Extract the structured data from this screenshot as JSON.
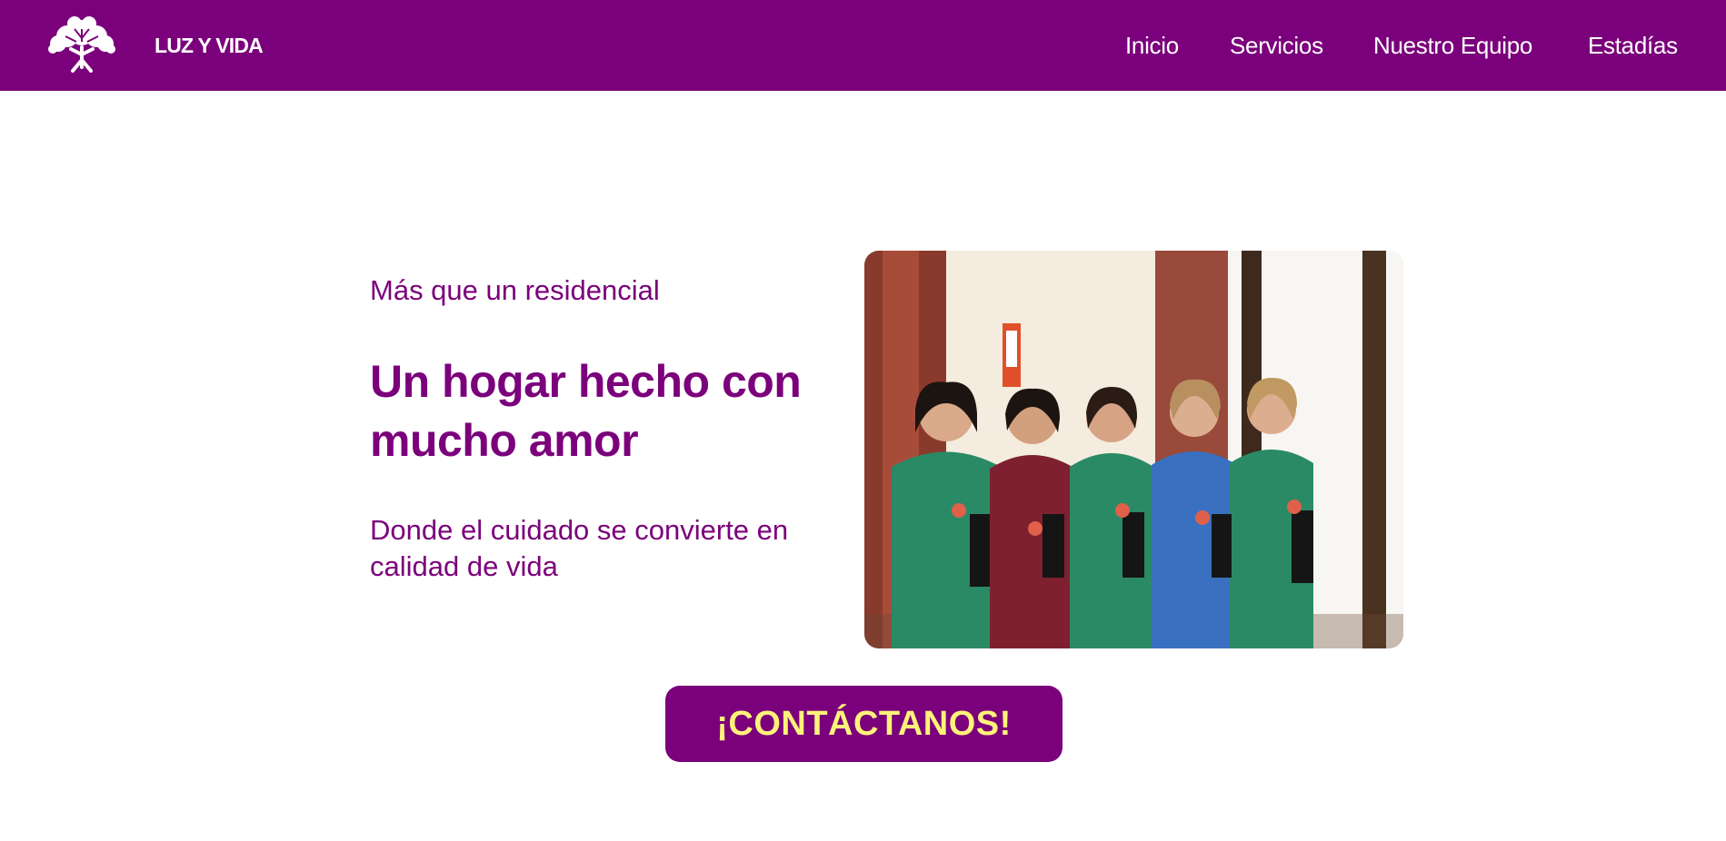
{
  "header": {
    "brand": "LUZ Y VIDA",
    "logo_icon": "tree-icon",
    "nav": [
      {
        "label": "Inicio"
      },
      {
        "label": "Servicios"
      },
      {
        "label": "Nuestro Equipo"
      },
      {
        "label": "Estadías"
      }
    ]
  },
  "hero": {
    "subtitle": "Más que un residencial",
    "headline": "Un hogar hecho con mucho amor",
    "tagline": "Donde el cuidado se convierte en calidad de vida",
    "photo": "team-photo"
  },
  "cta": {
    "label": "¡CONTÁCTANOS!"
  },
  "colors": {
    "brand_purple": "#7b007b",
    "cta_text_yellow": "#fff27a",
    "background": "#ffffff"
  }
}
